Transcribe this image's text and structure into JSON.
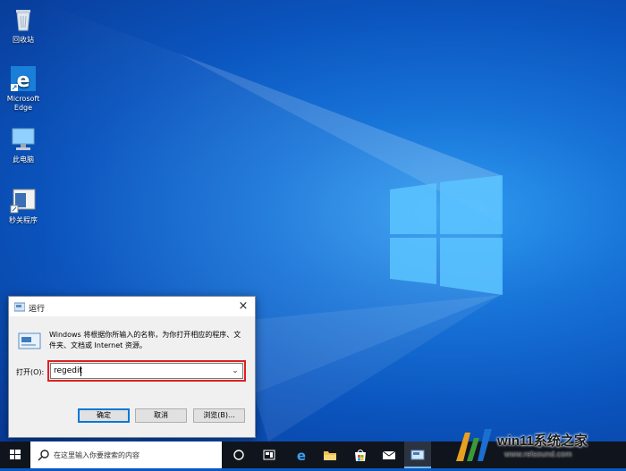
{
  "desktop": {
    "icons": [
      {
        "label": "回收站"
      },
      {
        "label": "Microsoft Edge"
      },
      {
        "label": "此电脑"
      },
      {
        "label": "秒关程序"
      }
    ]
  },
  "run_dialog": {
    "title": "运行",
    "close_label": "×",
    "description": "Windows 将根据你所输入的名称，为你打开相应的程序、文件夹、文档或 Internet 资源。",
    "open_label": "打开(O):",
    "input_value": "regedit",
    "ok_label": "确定",
    "cancel_label": "取消",
    "browse_label": "浏览(B)..."
  },
  "taskbar": {
    "search_placeholder": "在这里输入你要搜索的内容"
  },
  "watermark": {
    "text": "win11系统之家",
    "url": "www.relsound.com"
  },
  "colors": {
    "accent": "#0078d7",
    "highlight_frame": "#e02020",
    "taskbar": "#10151d"
  }
}
